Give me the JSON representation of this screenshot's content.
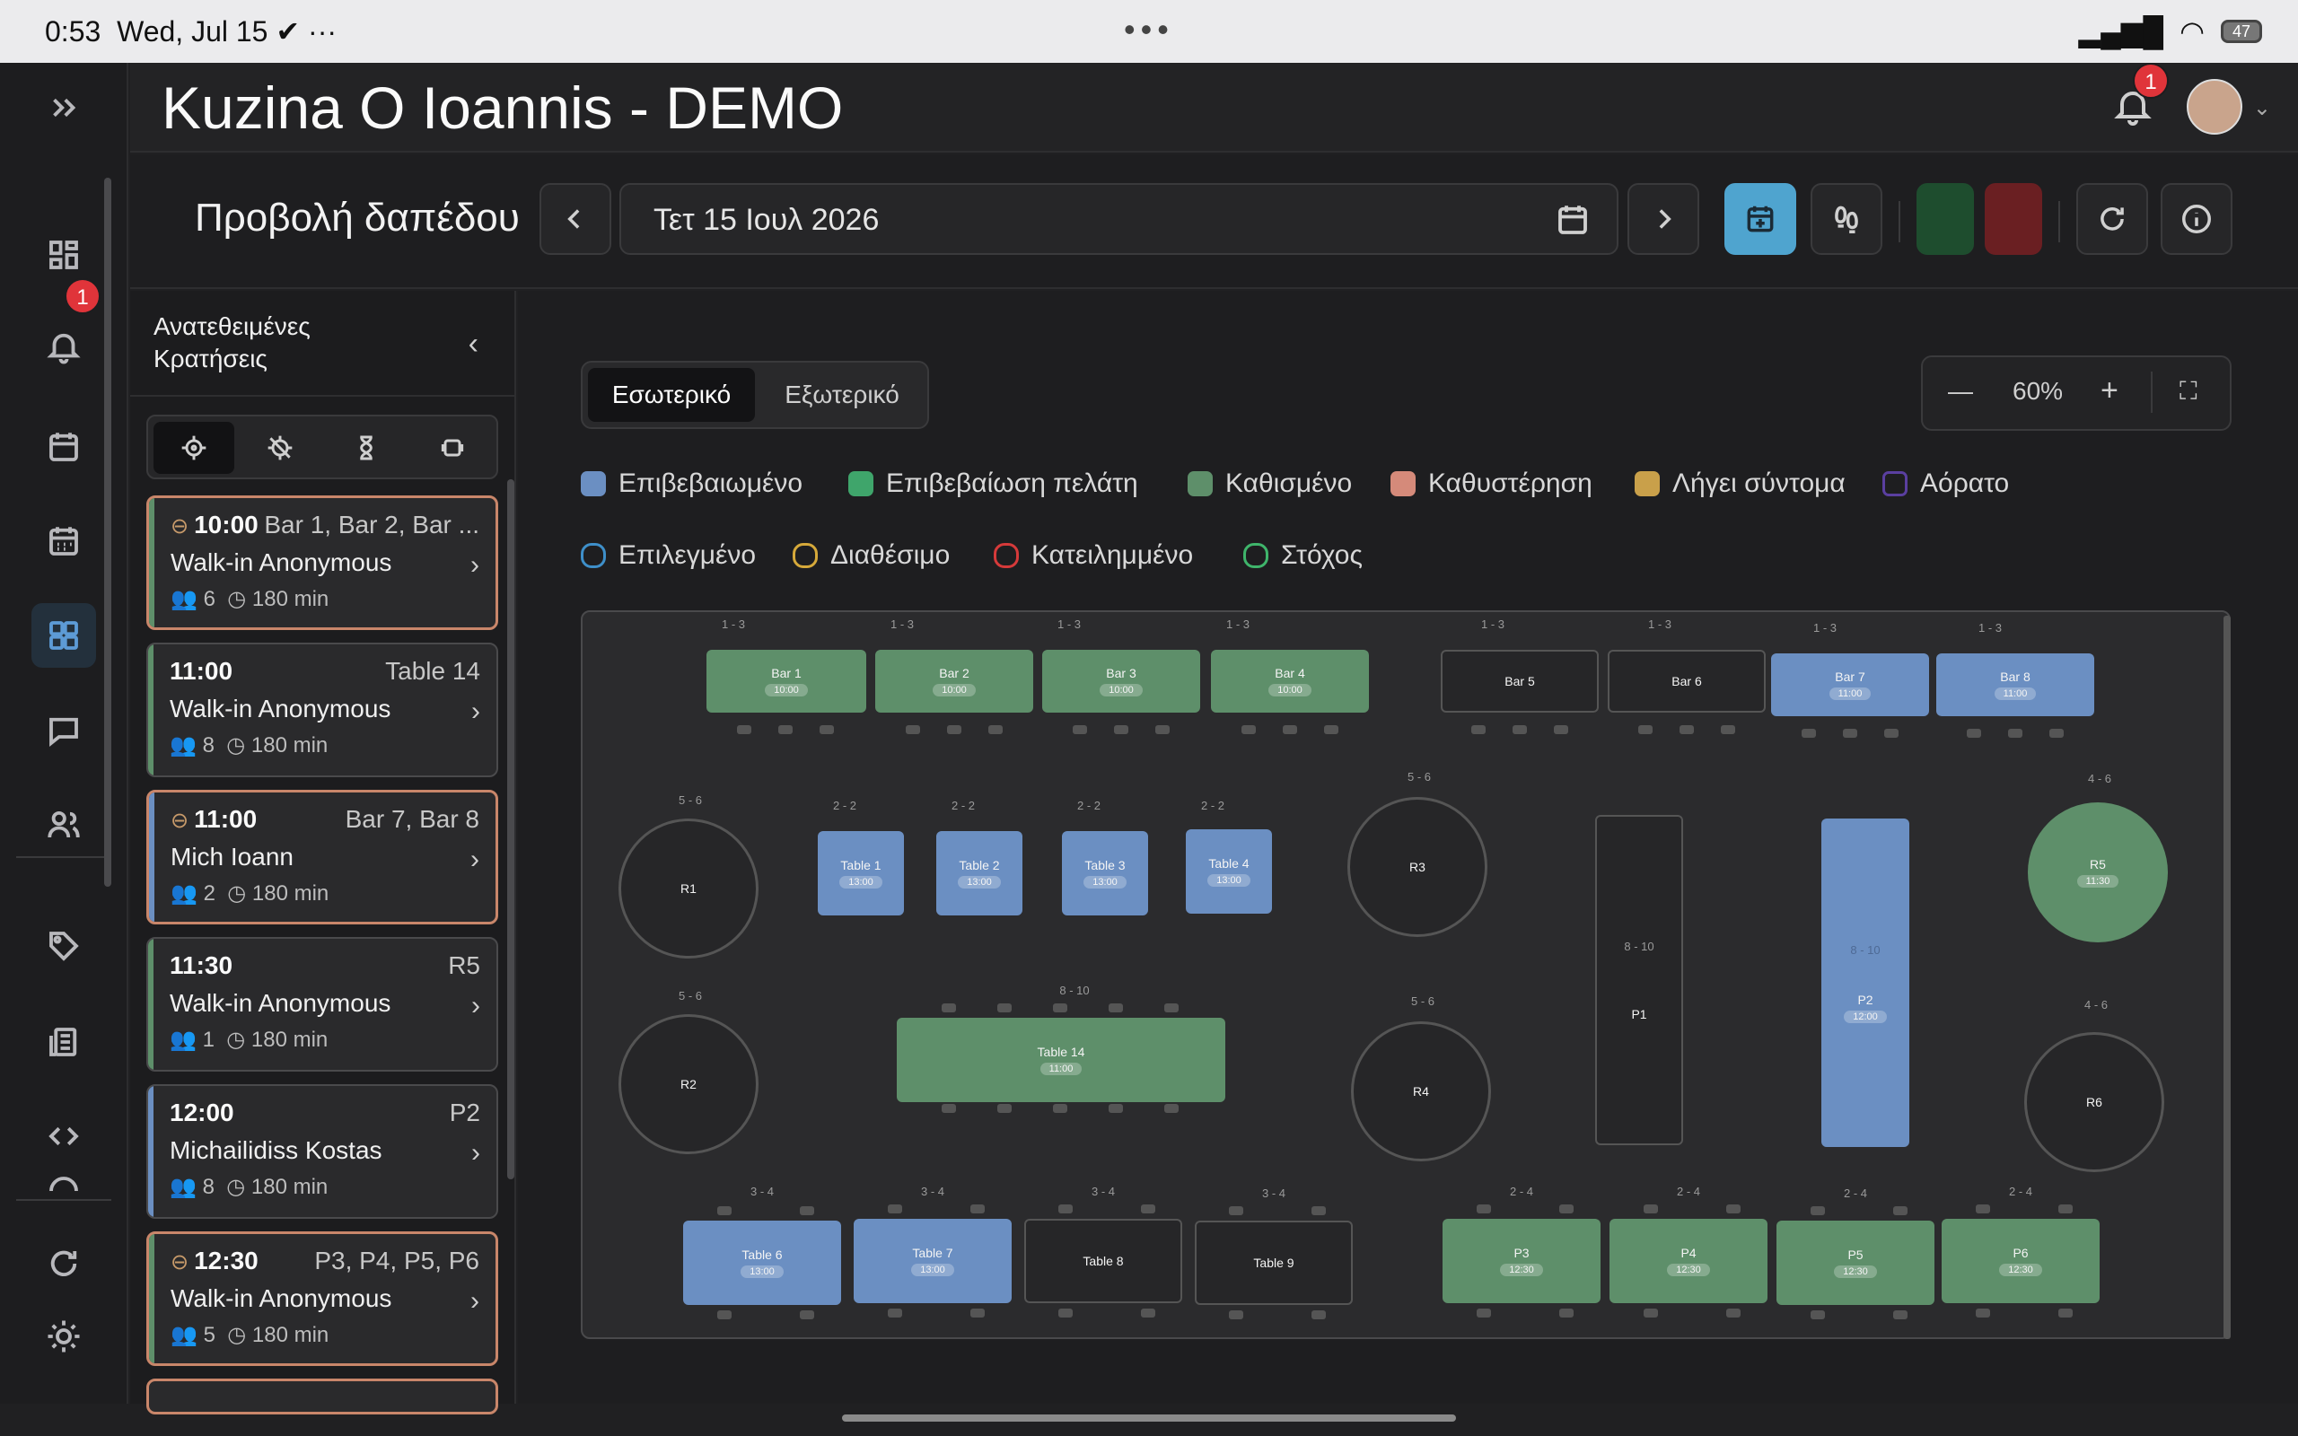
{
  "status_bar": {
    "time": "0:53",
    "date": "Wed, Jul 15",
    "battery": "47"
  },
  "app": {
    "title": "Kuzina O Ioannis - DEMO",
    "notifications_badge": "1",
    "sidebar_badge": "1"
  },
  "toolbar": {
    "view_label": "Προβολή δαπέδου",
    "date_value": "Τετ 15 Ιουλ 2026"
  },
  "left_panel": {
    "title_line1": "Ανατεθειμένες",
    "title_line2": "Κρατήσεις",
    "reservations": [
      {
        "time": "10:00",
        "tables": "Bar 1, Bar 2, Bar ...",
        "name": "Walk-in Anonymous",
        "guests": "6",
        "duration": "180 min",
        "linked": true,
        "late": true
      },
      {
        "time": "11:00",
        "tables": "Table 14",
        "name": "Walk-in Anonymous",
        "guests": "8",
        "duration": "180 min",
        "linked": false,
        "late": false
      },
      {
        "time": "11:00",
        "tables": "Bar 7, Bar 8",
        "name": "Mich Ioann",
        "guests": "2",
        "duration": "180 min",
        "linked": true,
        "late": true
      },
      {
        "time": "11:30",
        "tables": "R5",
        "name": "Walk-in Anonymous",
        "guests": "1",
        "duration": "180 min",
        "linked": false,
        "late": false
      },
      {
        "time": "12:00",
        "tables": "P2",
        "name": "Michailidiss Kostas",
        "guests": "8",
        "duration": "180 min",
        "linked": false,
        "late": false
      },
      {
        "time": "12:30",
        "tables": "P3, P4, P5, P6",
        "name": "Walk-in Anonymous",
        "guests": "5",
        "duration": "180 min",
        "linked": true,
        "late": true
      }
    ]
  },
  "floor": {
    "tab_inside": "Εσωτερικό",
    "tab_outside": "Εξωτερικό",
    "zoom": "60%",
    "legend_fill": [
      {
        "label": "Επιβεβαιωμένο",
        "color": "#6b8fc2"
      },
      {
        "label": "Επιβεβαίωση πελάτη",
        "color": "#3fa56b"
      },
      {
        "label": "Καθισμένο",
        "color": "#5e8f6a"
      },
      {
        "label": "Καθυστέρηση",
        "color": "#d58a7a"
      },
      {
        "label": "Λήγει σύντομα",
        "color": "#c9a04a"
      },
      {
        "label": "Αόρατο",
        "color": "#5a3fa0"
      }
    ],
    "legend_outline": [
      {
        "label": "Επιλεγμένο",
        "color": "#3e8fc9"
      },
      {
        "label": "Διαθέσιμο",
        "color": "#d6a93a"
      },
      {
        "label": "Κατειλημμένο",
        "color": "#d63a3a"
      },
      {
        "label": "Στόχος",
        "color": "#3fb56b"
      }
    ],
    "tables": {
      "bar1": {
        "name": "Bar 1",
        "cap": "1 - 3",
        "time": "10:00"
      },
      "bar2": {
        "name": "Bar 2",
        "cap": "1 - 3",
        "time": "10:00"
      },
      "bar3": {
        "name": "Bar 3",
        "cap": "1 - 3",
        "time": "10:00"
      },
      "bar4": {
        "name": "Bar 4",
        "cap": "1 - 3",
        "time": "10:00"
      },
      "bar5": {
        "name": "Bar 5",
        "cap": "1 - 3"
      },
      "bar6": {
        "name": "Bar 6",
        "cap": "1 - 3"
      },
      "bar7": {
        "name": "Bar 7",
        "cap": "1 - 3",
        "time": "11:00"
      },
      "bar8": {
        "name": "Bar 8",
        "cap": "1 - 3",
        "time": "11:00"
      },
      "r1": {
        "name": "R1",
        "cap": "5 - 6"
      },
      "r2": {
        "name": "R2",
        "cap": "5 - 6"
      },
      "r3": {
        "name": "R3",
        "cap": "5 - 6"
      },
      "r4": {
        "name": "R4",
        "cap": "5 - 6"
      },
      "r5": {
        "name": "R5",
        "cap": "4 - 6",
        "time": "11:30"
      },
      "r6": {
        "name": "R6",
        "cap": "4 - 6"
      },
      "t1": {
        "name": "Table 1",
        "cap": "2 - 2",
        "time": "13:00"
      },
      "t2": {
        "name": "Table 2",
        "cap": "2 - 2",
        "time": "13:00"
      },
      "t3": {
        "name": "Table 3",
        "cap": "2 - 2",
        "time": "13:00"
      },
      "t4": {
        "name": "Table 4",
        "cap": "2 - 2",
        "time": "13:00"
      },
      "t14": {
        "name": "Table 14",
        "cap": "8 - 10",
        "time": "11:00"
      },
      "p1": {
        "name": "P1",
        "cap": "8 - 10"
      },
      "p2": {
        "name": "P2",
        "cap": "8 - 10",
        "time": "12:00"
      },
      "t6": {
        "name": "Table 6",
        "cap": "3 - 4",
        "time": "13:00"
      },
      "t7": {
        "name": "Table 7",
        "cap": "3 - 4",
        "time": "13:00"
      },
      "t8": {
        "name": "Table 8",
        "cap": "3 - 4"
      },
      "t9": {
        "name": "Table 9",
        "cap": "3 - 4"
      },
      "p3": {
        "name": "P3",
        "cap": "2 - 4",
        "time": "12:30"
      },
      "p4": {
        "name": "P4",
        "cap": "2 - 4",
        "time": "12:30"
      },
      "p5": {
        "name": "P5",
        "cap": "2 - 4",
        "time": "12:30"
      },
      "p6": {
        "name": "P6",
        "cap": "2 - 4",
        "time": "12:30"
      }
    }
  }
}
